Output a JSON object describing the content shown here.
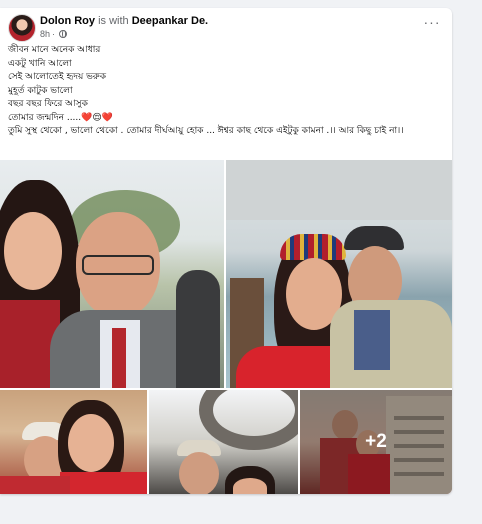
{
  "post": {
    "author": "Dolon Roy",
    "with_text": "is with",
    "tagged": "Deepankar De.",
    "time": "8h",
    "time_sep": "·",
    "more_label": "···",
    "lines": [
      "জীবন মানে অনেক আধার",
      "একটু খানি আলো",
      "সেই আলোতেই হৃদয় ভরুক",
      "মুহূর্ত কাটুক ভালো",
      "বছর বছর ফিরে আসুক",
      "তোমার জন্মদিন .....❤️😌❤️",
      "তুমি সুস্থ থেকো , ভালো থেকো . তোমার দীর্ঘআয়ু হোক ... ঈশ্বর কাছ থেকে এইটুকু কামনা .।। আর কিছু চাই না।।"
    ]
  },
  "gallery": {
    "extra_count": "+2",
    "photos": [
      {
        "subject": "selfie-woman-and-man-in-suit"
      },
      {
        "subject": "woman-in-red-and-man-in-cap"
      },
      {
        "subject": "man-in-cap-and-woman-in-red"
      },
      {
        "subject": "man-with-glasses-and-woman"
      },
      {
        "subject": "couple-on-rooftop"
      }
    ]
  },
  "colors": {
    "page_bg": "#f0f2f5",
    "card_bg": "#ffffff",
    "text_primary": "#050505",
    "text_secondary": "#65676b",
    "accent_red": "#c9252d"
  }
}
